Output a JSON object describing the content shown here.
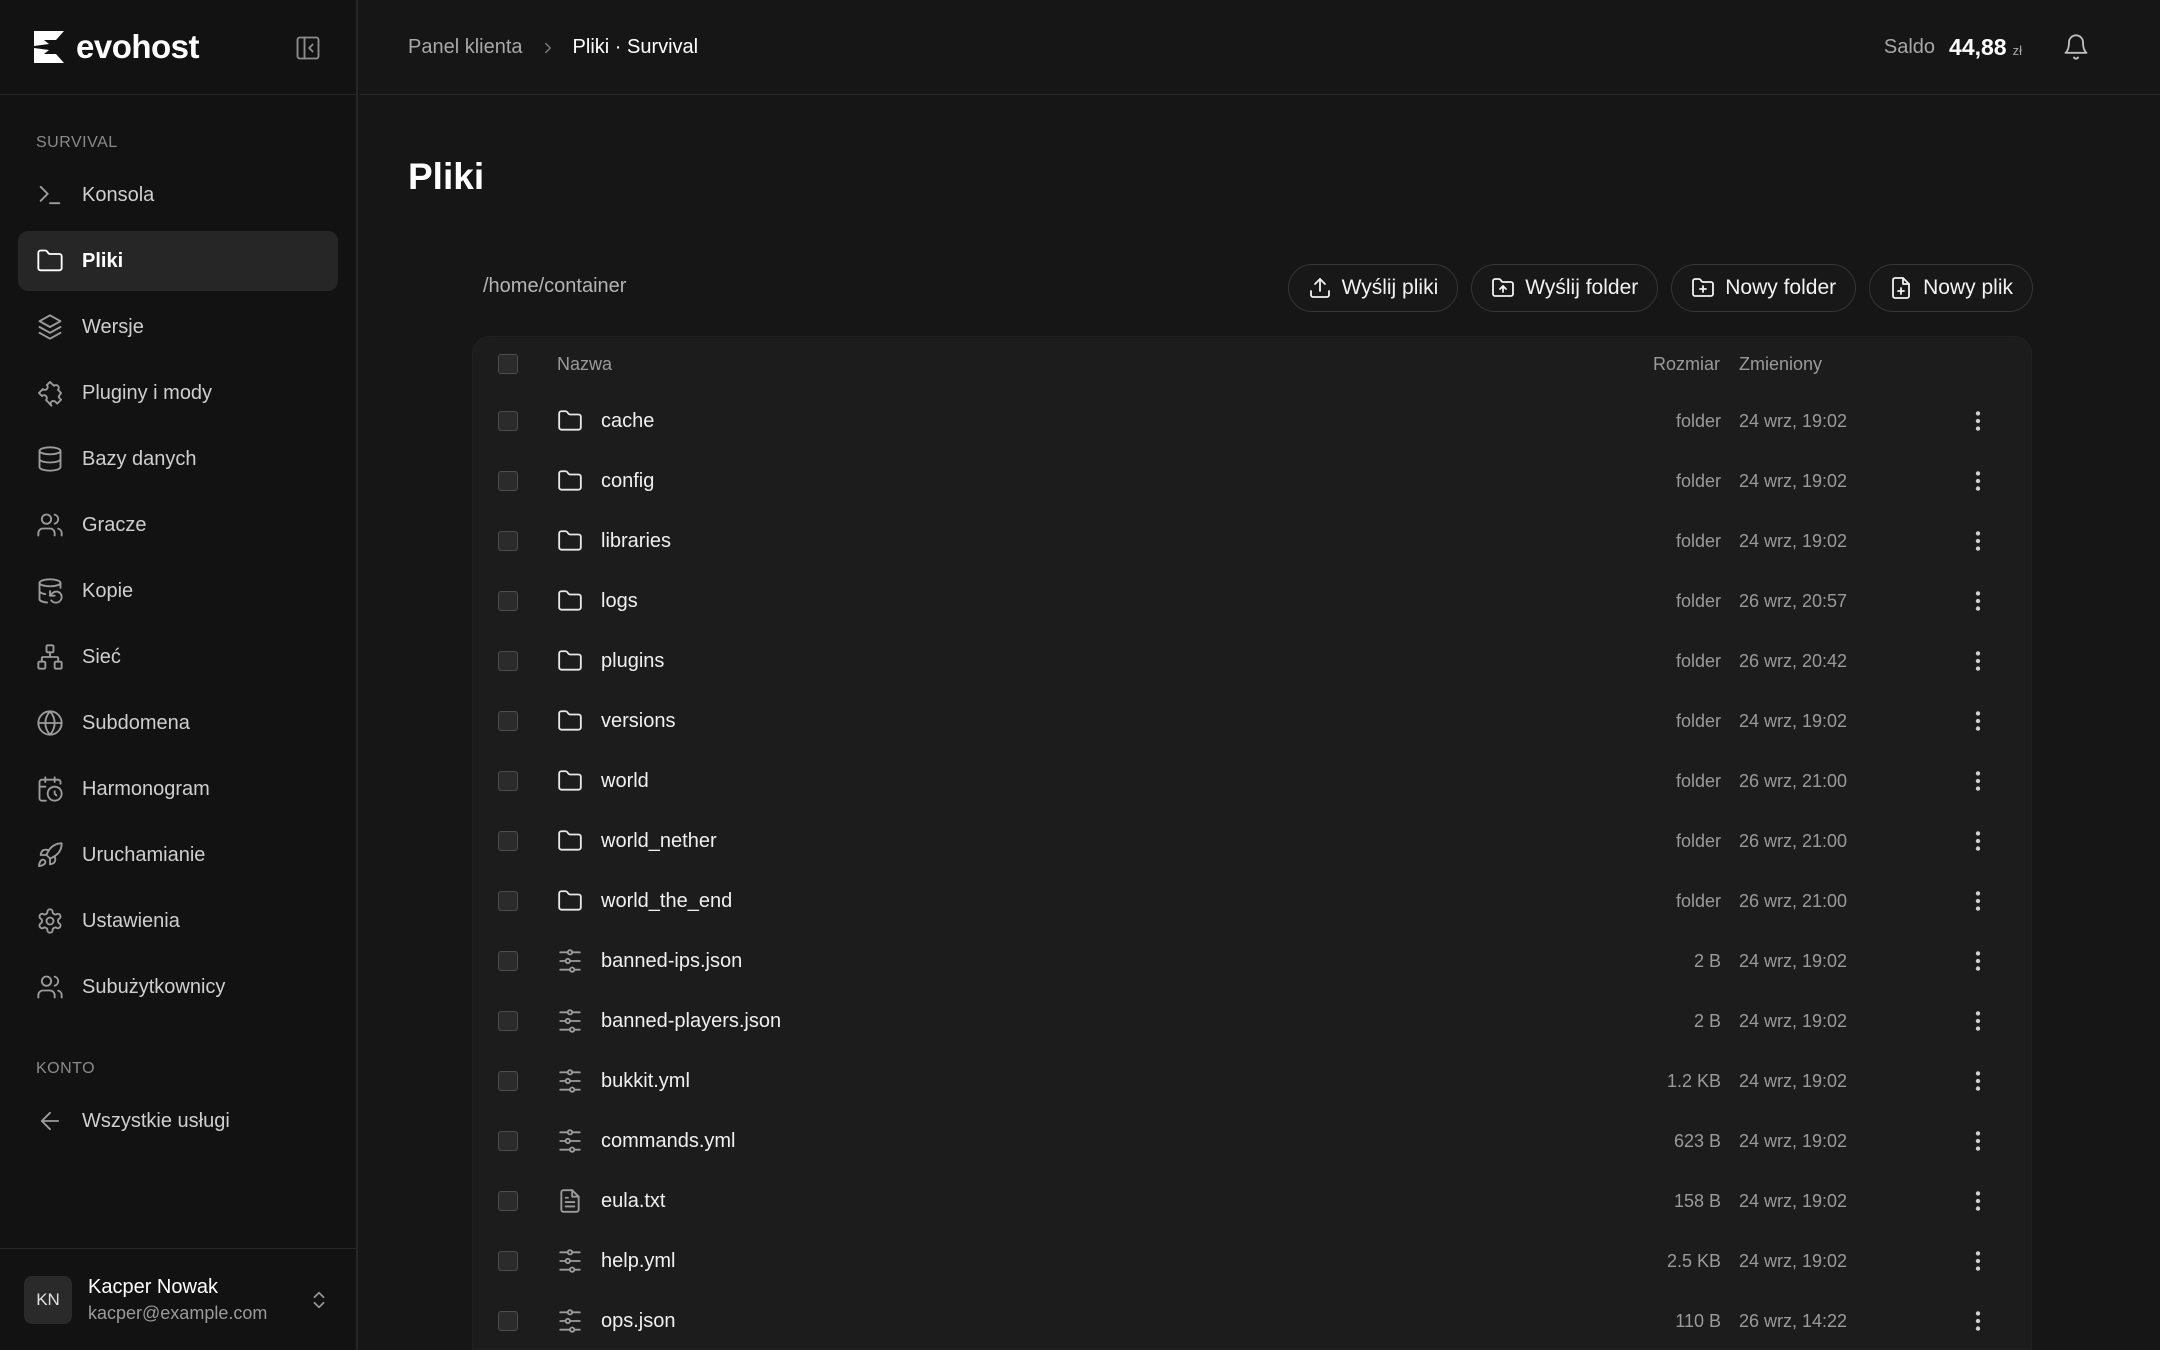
{
  "brand": {
    "name": "evohost"
  },
  "sidebar": {
    "section_service": "SURVIVAL",
    "items": [
      {
        "label": "Konsola",
        "icon": "terminal-icon",
        "active": false
      },
      {
        "label": "Pliki",
        "icon": "folder-icon",
        "active": true
      },
      {
        "label": "Wersje",
        "icon": "layers-icon",
        "active": false
      },
      {
        "label": "Pluginy i mody",
        "icon": "puzzle-icon",
        "active": false
      },
      {
        "label": "Bazy danych",
        "icon": "database-icon",
        "active": false
      },
      {
        "label": "Gracze",
        "icon": "users-icon",
        "active": false
      },
      {
        "label": "Kopie",
        "icon": "database-backup-icon",
        "active": false
      },
      {
        "label": "Sieć",
        "icon": "network-icon",
        "active": false
      },
      {
        "label": "Subdomena",
        "icon": "globe-icon",
        "active": false
      },
      {
        "label": "Harmonogram",
        "icon": "calendar-clock-icon",
        "active": false
      },
      {
        "label": "Uruchamianie",
        "icon": "rocket-icon",
        "active": false
      },
      {
        "label": "Ustawienia",
        "icon": "gear-icon",
        "active": false
      },
      {
        "label": "Subużytkownicy",
        "icon": "users-icon",
        "active": false
      }
    ],
    "section_account": "KONTO",
    "account_items": [
      {
        "label": "Wszystkie usługi",
        "icon": "arrow-left-icon"
      }
    ],
    "user": {
      "initials": "KN",
      "name": "Kacper Nowak",
      "email": "kacper@example.com"
    }
  },
  "header": {
    "breadcrumb_parent": "Panel klienta",
    "breadcrumb_current": "Pliki · Survival",
    "balance_label": "Saldo",
    "balance_value": "44,88",
    "balance_unit": "zł"
  },
  "main": {
    "title": "Pliki",
    "path": "/home/container",
    "actions": [
      {
        "label": "Wyślij pliki",
        "icon": "upload-icon"
      },
      {
        "label": "Wyślij folder",
        "icon": "folder-upload-icon"
      },
      {
        "label": "Nowy folder",
        "icon": "folder-plus-icon"
      },
      {
        "label": "Nowy plik",
        "icon": "file-plus-icon"
      }
    ],
    "columns": {
      "name": "Nazwa",
      "size": "Rozmiar",
      "modified": "Zmieniony"
    },
    "files": [
      {
        "name": "cache",
        "type": "folder",
        "size": "folder",
        "modified": "24 wrz, 19:02"
      },
      {
        "name": "config",
        "type": "folder",
        "size": "folder",
        "modified": "24 wrz, 19:02"
      },
      {
        "name": "libraries",
        "type": "folder",
        "size": "folder",
        "modified": "24 wrz, 19:02"
      },
      {
        "name": "logs",
        "type": "folder",
        "size": "folder",
        "modified": "26 wrz, 20:57"
      },
      {
        "name": "plugins",
        "type": "folder",
        "size": "folder",
        "modified": "26 wrz, 20:42"
      },
      {
        "name": "versions",
        "type": "folder",
        "size": "folder",
        "modified": "24 wrz, 19:02"
      },
      {
        "name": "world",
        "type": "folder",
        "size": "folder",
        "modified": "26 wrz, 21:00"
      },
      {
        "name": "world_nether",
        "type": "folder",
        "size": "folder",
        "modified": "26 wrz, 21:00"
      },
      {
        "name": "world_the_end",
        "type": "folder",
        "size": "folder",
        "modified": "26 wrz, 21:00"
      },
      {
        "name": "banned-ips.json",
        "type": "config",
        "size": "2 B",
        "modified": "24 wrz, 19:02"
      },
      {
        "name": "banned-players.json",
        "type": "config",
        "size": "2 B",
        "modified": "24 wrz, 19:02"
      },
      {
        "name": "bukkit.yml",
        "type": "config",
        "size": "1.2 KB",
        "modified": "24 wrz, 19:02"
      },
      {
        "name": "commands.yml",
        "type": "config",
        "size": "623 B",
        "modified": "24 wrz, 19:02"
      },
      {
        "name": "eula.txt",
        "type": "text",
        "size": "158 B",
        "modified": "24 wrz, 19:02"
      },
      {
        "name": "help.yml",
        "type": "config",
        "size": "2.5 KB",
        "modified": "24 wrz, 19:02"
      },
      {
        "name": "ops.json",
        "type": "config",
        "size": "110 B",
        "modified": "26 wrz, 14:22"
      }
    ]
  }
}
